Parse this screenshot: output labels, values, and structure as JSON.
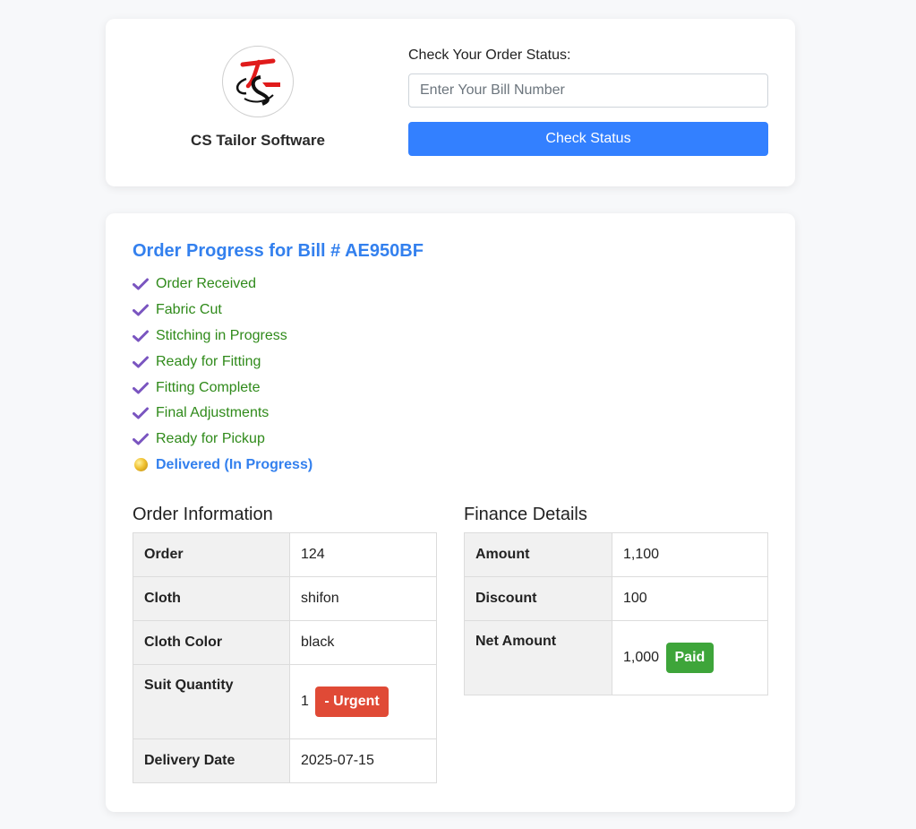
{
  "brand": {
    "name": "CS Tailor Software"
  },
  "status_check": {
    "label": "Check Your Order Status:",
    "input_placeholder": "Enter Your Bill Number",
    "input_value": "",
    "button_label": "Check Status"
  },
  "progress": {
    "title": "Order Progress for Bill # AE950BF",
    "steps": [
      {
        "label": "Order Received",
        "state": "done"
      },
      {
        "label": "Fabric Cut",
        "state": "done"
      },
      {
        "label": "Stitching in Progress",
        "state": "done"
      },
      {
        "label": "Ready for Fitting",
        "state": "done"
      },
      {
        "label": "Fitting Complete",
        "state": "done"
      },
      {
        "label": "Final Adjustments",
        "state": "done"
      },
      {
        "label": "Ready for Pickup",
        "state": "done"
      },
      {
        "label": "Delivered (In Progress)",
        "state": "current"
      }
    ]
  },
  "order_info": {
    "title": "Order Information",
    "rows": [
      {
        "key": "Order",
        "value": "124"
      },
      {
        "key": "Cloth",
        "value": "shifon"
      },
      {
        "key": "Cloth Color",
        "value": "black"
      },
      {
        "key": "Suit Quantity",
        "value": "1",
        "badge": "- Urgent"
      },
      {
        "key": "Delivery Date",
        "value": "2025-07-15"
      }
    ]
  },
  "finance": {
    "title": "Finance Details",
    "rows": [
      {
        "key": "Amount",
        "value": "1,100"
      },
      {
        "key": "Discount",
        "value": "100"
      },
      {
        "key": "Net Amount",
        "value": "1,000",
        "badge": "Paid"
      }
    ]
  },
  "colors": {
    "accent": "#3380ff",
    "step_done": "#2f8a1a",
    "check_icon": "#7a55c0",
    "urgent": "#e04a36",
    "paid": "#3ea53a"
  },
  "icons": {
    "step_done": "checkmark-icon",
    "step_current": "yellow-dot-icon"
  }
}
